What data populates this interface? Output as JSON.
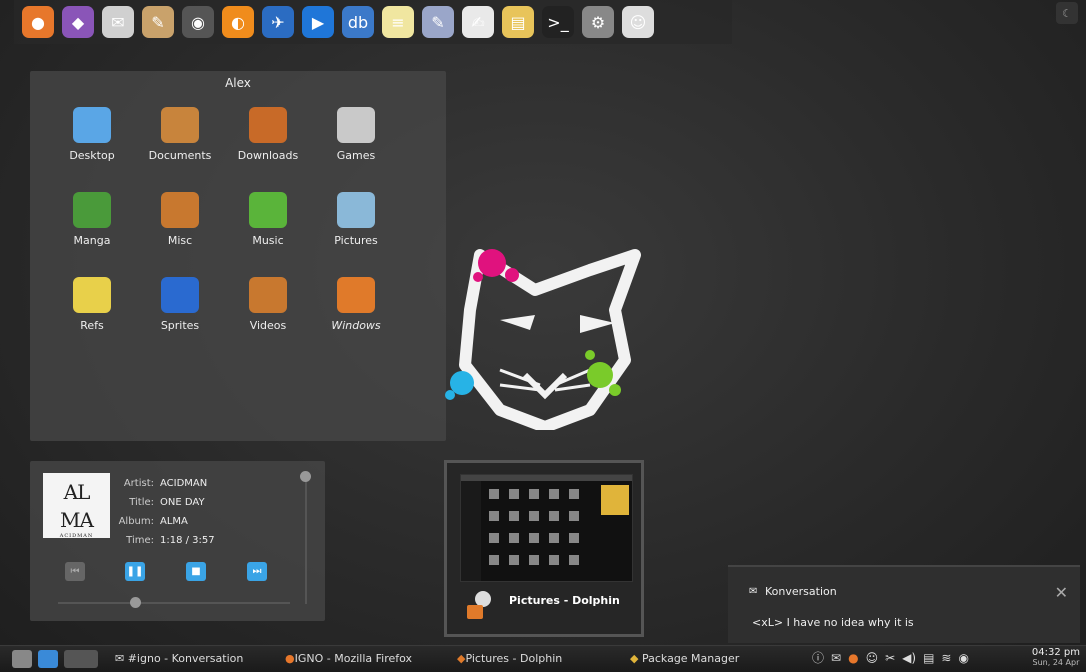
{
  "dock": {
    "apps": [
      {
        "name": "firefox-icon",
        "color": "#e7772b",
        "glyph": "●"
      },
      {
        "name": "pidgin-icon",
        "color": "#8a55b8",
        "glyph": "◆"
      },
      {
        "name": "konversation-icon",
        "color": "#d0d0d0",
        "glyph": "✉"
      },
      {
        "name": "paint-icon",
        "color": "#c9a26b",
        "glyph": "✎"
      },
      {
        "name": "mouse-icon",
        "color": "#555",
        "glyph": "◉"
      },
      {
        "name": "orange-icon",
        "color": "#f08c1c",
        "glyph": "◐"
      },
      {
        "name": "launcher-icon",
        "color": "#2b6cc2",
        "glyph": "✈"
      },
      {
        "name": "media-player-icon",
        "color": "#1f76d8",
        "glyph": "▶"
      },
      {
        "name": "database-icon",
        "color": "#3b79c9",
        "glyph": "db"
      },
      {
        "name": "notes-icon",
        "color": "#f0e6a0",
        "glyph": "≡"
      },
      {
        "name": "editor-icon",
        "color": "#9aa6c9",
        "glyph": "✎"
      },
      {
        "name": "writer-icon",
        "color": "#e9e9e9",
        "glyph": "✍"
      },
      {
        "name": "archive-icon",
        "color": "#e8c45a",
        "glyph": "▤"
      },
      {
        "name": "terminal-icon",
        "color": "#222",
        "glyph": ">_"
      },
      {
        "name": "settings-icon",
        "color": "#888",
        "glyph": "⚙"
      },
      {
        "name": "cat-icon",
        "color": "#ddd",
        "glyph": "☺"
      }
    ]
  },
  "folder": {
    "title": "Alex",
    "items": [
      {
        "label": "Desktop",
        "color": "#5aa6e6"
      },
      {
        "label": "Documents",
        "color": "#c8843c"
      },
      {
        "label": "Downloads",
        "color": "#c86a28"
      },
      {
        "label": "Games",
        "color": "#c9c9c9"
      },
      {
        "label": "Manga",
        "color": "#4a9a3a"
      },
      {
        "label": "Misc",
        "color": "#c8782f"
      },
      {
        "label": "Music",
        "color": "#5ab43a"
      },
      {
        "label": "Pictures",
        "color": "#8ab8d8"
      },
      {
        "label": "Refs",
        "color": "#e8d04a"
      },
      {
        "label": "Sprites",
        "color": "#2a6ad0"
      },
      {
        "label": "Videos",
        "color": "#c8782f"
      },
      {
        "label": "Windows",
        "color": "#e07a2a"
      }
    ]
  },
  "player": {
    "cover": {
      "line1": "AL",
      "line2": "MA",
      "line3": "ACIDMAN"
    },
    "artist_label": "Artist:",
    "artist": "ACIDMAN",
    "title_label": "Title:",
    "title": "ONE DAY",
    "album_label": "Album:",
    "album": "ALMA",
    "time_label": "Time:",
    "time": "1:18 / 3:57",
    "progress": 0.33,
    "volume": 1.0
  },
  "preview": {
    "label": "Pictures - Dolphin"
  },
  "notification": {
    "title": "Konversation",
    "message": "<xL> I have no idea why it is",
    "close": "✕"
  },
  "taskbar": {
    "tasks": [
      "#igno - Konversation",
      "IGNO - Mozilla Firefox",
      "Pictures - Dolphin",
      "Package Manager"
    ],
    "clock": {
      "time": "04:32 pm",
      "date": "Sun, 24 Apr"
    }
  }
}
